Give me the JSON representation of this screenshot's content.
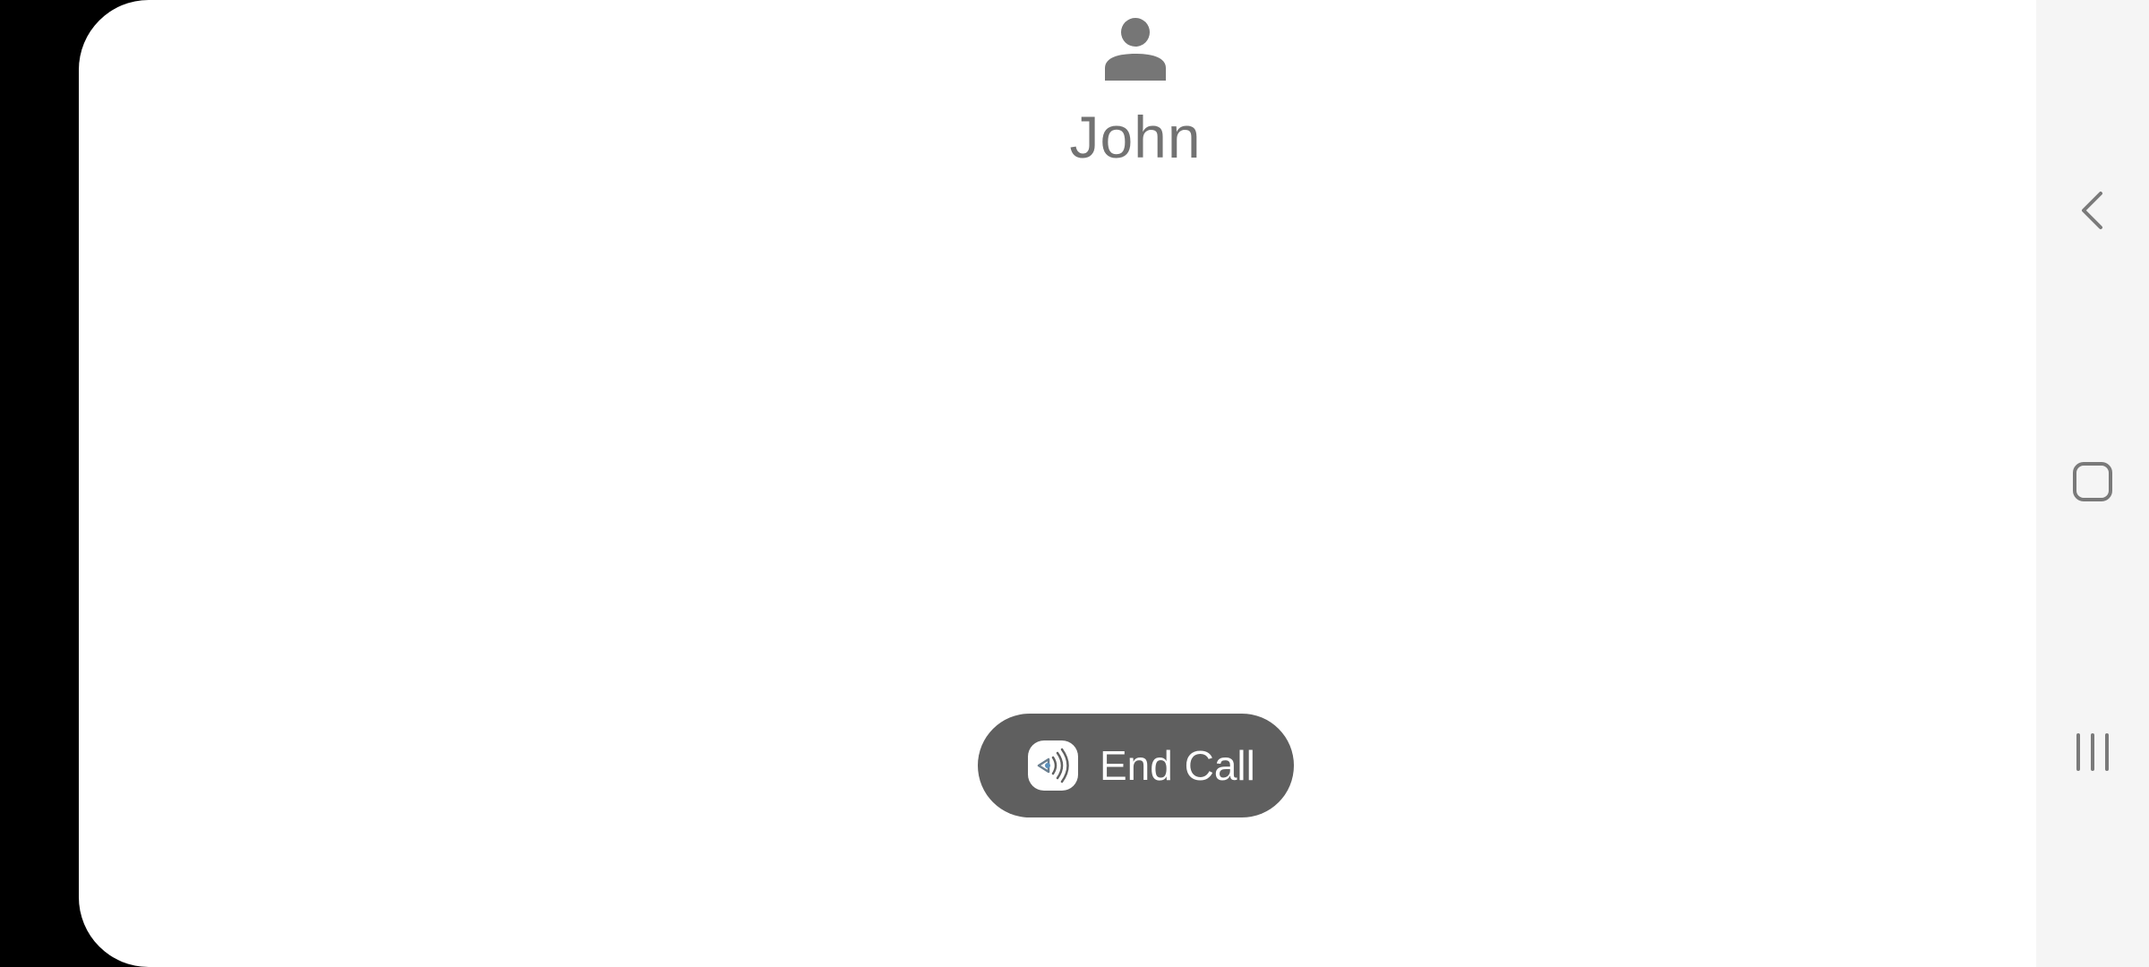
{
  "call": {
    "contact_name": "John",
    "avatar_icon": "person-icon",
    "end_call_label": "End Call",
    "end_call_icon": "speaker-volume-icon"
  },
  "navigation": {
    "back_icon": "back-chevron-icon",
    "home_icon": "home-square-icon",
    "recents_icon": "recents-bars-icon"
  },
  "colors": {
    "surface": "#ffffff",
    "avatar_gray": "#767676",
    "name_gray": "#727272",
    "end_call_background": "#5f5f5f",
    "nav_background": "#f5f5f5",
    "nav_icon": "#7a7a7a"
  }
}
